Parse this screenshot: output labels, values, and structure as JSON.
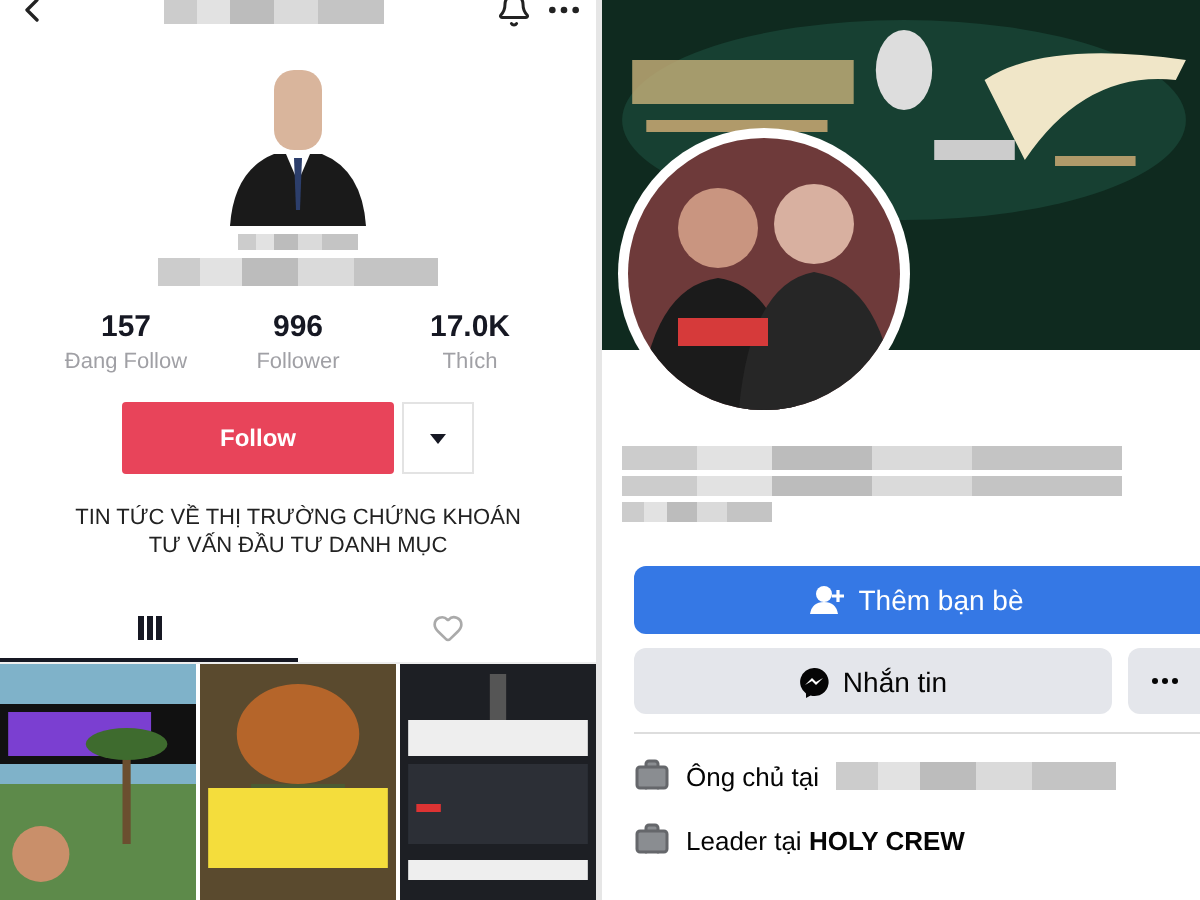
{
  "tiktok_profile": {
    "header": {
      "name_redacted": true
    },
    "avatar": {
      "kind": "figure"
    },
    "name_redacted": true,
    "stats": [
      {
        "value": "157",
        "label": "Đang Follow"
      },
      {
        "value": "996",
        "label": "Follower"
      },
      {
        "value": "17.0K",
        "label": "Thích"
      }
    ],
    "follow_button": "Follow",
    "bio": [
      "TIN TỨC VỀ THỊ TRƯỜNG CHỨNG KHOÁN",
      "TƯ VẤN ĐẦU TƯ DANH MỤC"
    ],
    "tabs": [
      {
        "kind": "videos",
        "selected": true
      },
      {
        "kind": "liked",
        "selected": false
      }
    ],
    "videos": [
      {
        "kind": "beach"
      },
      {
        "kind": "caption"
      },
      {
        "kind": "chart"
      }
    ]
  },
  "facebook_profile": {
    "name_redacted": true,
    "add_friend_button": "Thêm bạn bè",
    "message_button": "Nhắn tin",
    "about": [
      {
        "text": "Ông chủ tại",
        "redacted": true
      },
      {
        "text": "Leader tại **HOLY CREW**",
        "redacted": false
      }
    ]
  }
}
